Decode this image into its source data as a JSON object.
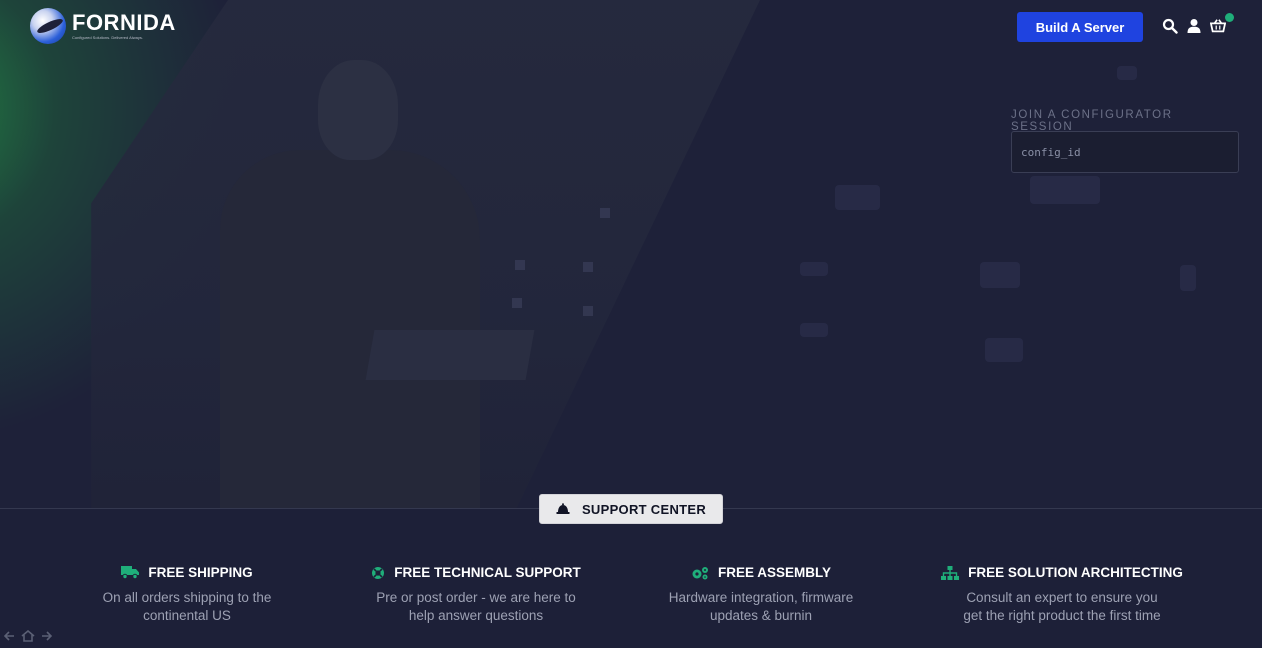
{
  "header": {
    "logo_name": "FORNIDA",
    "logo_tagline": "Configured Solutions. Delivered Always.",
    "build_button": "Build A Server",
    "icons": [
      "search-icon",
      "user-icon",
      "cart-icon"
    ]
  },
  "configurator": {
    "label": "JOIN A CONFIGURATOR SESSION",
    "placeholder": "config_id",
    "value": ""
  },
  "support": {
    "label": "SUPPORT CENTER",
    "icon": "bell-icon"
  },
  "features": [
    {
      "title": "FREE SHIPPING",
      "line1": "On all orders shipping to the",
      "line2": "continental US",
      "icon": "truck-icon"
    },
    {
      "title": "FREE TECHNICAL SUPPORT",
      "line1": "Pre or post order - we are here to",
      "line2": "help answer questions",
      "icon": "lifering-icon"
    },
    {
      "title": "FREE ASSEMBLY",
      "line1": "Hardware integration, firmware",
      "line2": "updates & burnin",
      "icon": "gears-icon"
    },
    {
      "title": "FREE SOLUTION ARCHITECTING",
      "line1": "Consult an expert to ensure you",
      "line2": "get the right product the first time",
      "icon": "sitemap-icon"
    }
  ],
  "colors": {
    "accent_blue": "#1f43e0",
    "accent_green": "#1fae7a",
    "background": "#1d2038"
  }
}
